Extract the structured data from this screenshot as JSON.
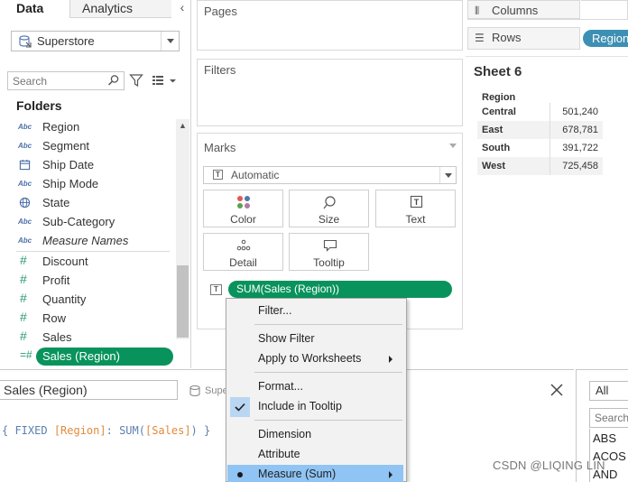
{
  "left_pane": {
    "tabs": {
      "data": "Data",
      "analytics": "Analytics"
    },
    "collapse_icon": "chevron-left-icon",
    "datasource": "Superstore",
    "search_placeholder": "Search",
    "folders_title": "Folders",
    "dimensions": [
      {
        "type": "Abc",
        "label": "Region"
      },
      {
        "type": "Abc",
        "label": "Segment"
      },
      {
        "type": "calendar",
        "label": "Ship Date"
      },
      {
        "type": "Abc",
        "label": "Ship Mode"
      },
      {
        "type": "globe",
        "label": "State"
      },
      {
        "type": "Abc",
        "label": "Sub-Category"
      },
      {
        "type": "Abc",
        "label": "Measure Names"
      }
    ],
    "measures": [
      {
        "type": "#",
        "label": "Discount"
      },
      {
        "type": "#",
        "label": "Profit"
      },
      {
        "type": "#",
        "label": "Quantity"
      },
      {
        "type": "#",
        "label": "Row"
      },
      {
        "type": "#",
        "label": "Sales"
      },
      {
        "type": "=#",
        "label": "Sales (Region)"
      }
    ]
  },
  "cards": {
    "pages": "Pages",
    "filters": "Filters",
    "marks": "Marks"
  },
  "marks": {
    "mark_type": "Automatic",
    "buttons": {
      "color": "Color",
      "size": "Size",
      "text": "Text",
      "detail": "Detail",
      "tooltip": "Tooltip"
    },
    "pill": "SUM(Sales (Region))"
  },
  "shelves": {
    "columns": "Columns",
    "rows": "Rows",
    "rows_pill": "Region"
  },
  "sheet": {
    "title": "Sheet 6",
    "column_header": "Region",
    "rows": [
      {
        "region": "Central",
        "value": "501,240"
      },
      {
        "region": "East",
        "value": "678,781"
      },
      {
        "region": "South",
        "value": "391,722"
      },
      {
        "region": "West",
        "value": "725,458"
      }
    ]
  },
  "calc": {
    "name": "Sales (Region)",
    "source": "Supe",
    "formula": {
      "open": "{ ",
      "fixed": "FIXED",
      "dim": "[Region]",
      "colon": ": ",
      "func": "SUM(",
      "measure": "[Sales]",
      "close": ") }"
    }
  },
  "functions": {
    "category": "All",
    "search_placeholder": "Search",
    "list": [
      "ABS",
      "ACOS",
      "AND"
    ]
  },
  "context_menu": {
    "filter": "Filter...",
    "show_filter": "Show Filter",
    "apply_to_worksheets": "Apply to Worksheets",
    "format": "Format...",
    "include_in_tooltip": "Include in Tooltip",
    "dimension": "Dimension",
    "attribute": "Attribute",
    "measure": "Measure (Sum)"
  },
  "watermark": "CSDN @LIQING LIN",
  "colors": {
    "measure_pill": "#09935c",
    "dimension_pill": "#3d90b3",
    "menu_highlight": "#8fc4f4"
  }
}
